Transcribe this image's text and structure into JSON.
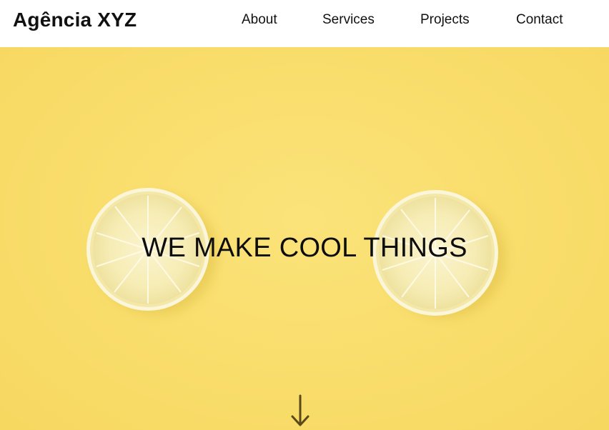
{
  "header": {
    "brand": "Agência XYZ",
    "nav": [
      "About",
      "Services",
      "Projects",
      "Contact"
    ]
  },
  "hero": {
    "headline": "WE MAKE COOL THINGS",
    "scroll_icon": "arrow-down-icon",
    "background_color": "#f9dd6b",
    "image_subject": "two lemon slices on a yellow background"
  },
  "colors": {
    "text": "#111111",
    "header_bg": "#ffffff",
    "hero_bg": "#f9dd6b",
    "arrow": "#5a4a1a"
  }
}
